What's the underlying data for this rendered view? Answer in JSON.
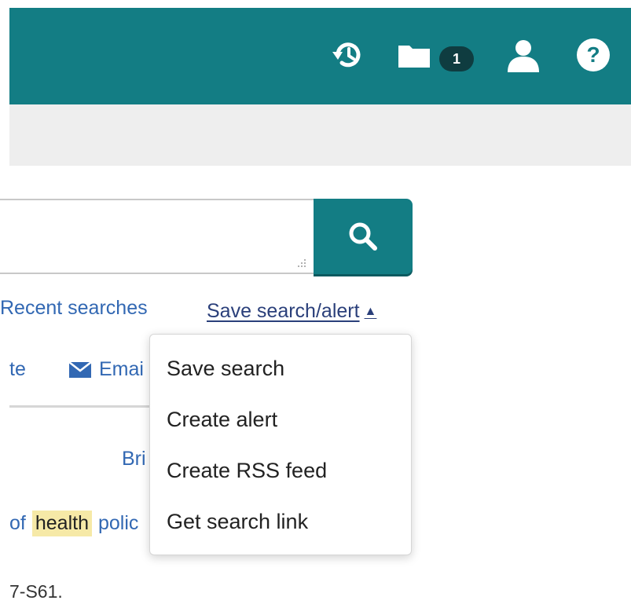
{
  "header": {
    "cart_count": "1"
  },
  "search": {
    "placeholder": ""
  },
  "links": {
    "recent_searches": "Recent searches",
    "save_search_alert": "Save search/alert",
    "caret": "▲"
  },
  "toolbar": {
    "partial_left": "te",
    "email": "Emai"
  },
  "results": {
    "partial_bri": "Bri",
    "of": "of",
    "highlight": "health",
    "polic": "polic",
    "page_ref": "7-S61."
  },
  "dropdown": {
    "items": [
      {
        "label": "Save search"
      },
      {
        "label": "Create alert"
      },
      {
        "label": "Create RSS feed"
      },
      {
        "label": "Get search link"
      }
    ]
  },
  "icons": {
    "history": "history-icon",
    "folder": "folder-icon",
    "user": "user-icon",
    "help": "help-icon",
    "search": "search-icon",
    "email": "email-icon"
  },
  "colors": {
    "brand": "#137d84",
    "link": "#3268b3",
    "highlight": "#f6e9a7"
  }
}
